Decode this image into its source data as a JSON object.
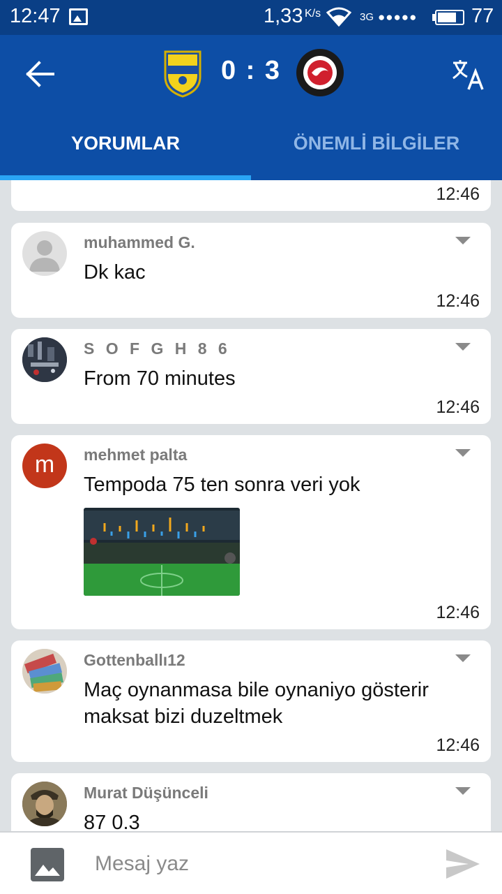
{
  "status_bar": {
    "time": "12:47",
    "speed": "1,33",
    "speed_unit": "K/s",
    "network": "3G",
    "signal": "●●●●●",
    "battery": "77",
    "battery_level": 0.77
  },
  "match": {
    "score": "0 : 3",
    "home_logo": "dunarea-logo",
    "away_logo": "fc-struga-logo",
    "back_icon": "arrow-left-icon",
    "translate_icon": "translate-icon"
  },
  "tabs": [
    {
      "label": "YORUMLAR",
      "active": true
    },
    {
      "label": "ÖNEMLİ BİLGİLER",
      "active": false
    }
  ],
  "comments": [
    {
      "author": "",
      "text": "",
      "time": "12:46"
    },
    {
      "author": "muhammed G.",
      "text": "Dk kac",
      "time": "12:46"
    },
    {
      "author": "S O F G H 8 6",
      "text": "From 70 minutes",
      "time": "12:46"
    },
    {
      "author": "mehmet palta",
      "avatar_letter": "m",
      "text": "Tempoda 75 ten sonra veri yok",
      "time": "12:46",
      "has_image": true
    },
    {
      "author": "Gottenballı12",
      "text": "Maç oynanmasa bile oynaniyo gösterir maksat bizi duzeltmek",
      "time": "12:46"
    },
    {
      "author": "Murat Düşünceli",
      "text": "87 0.3",
      "time": ""
    }
  ],
  "composer": {
    "placeholder": "Mesaj yaz",
    "gallery_icon": "image-icon",
    "send_icon": "send-icon"
  },
  "colors": {
    "header": "#0d4ea6",
    "status_bar": "#0a3f86",
    "tab_indicator": "#2aa5f5",
    "background": "#dde1e4",
    "avatar_m": "#c2361a"
  }
}
